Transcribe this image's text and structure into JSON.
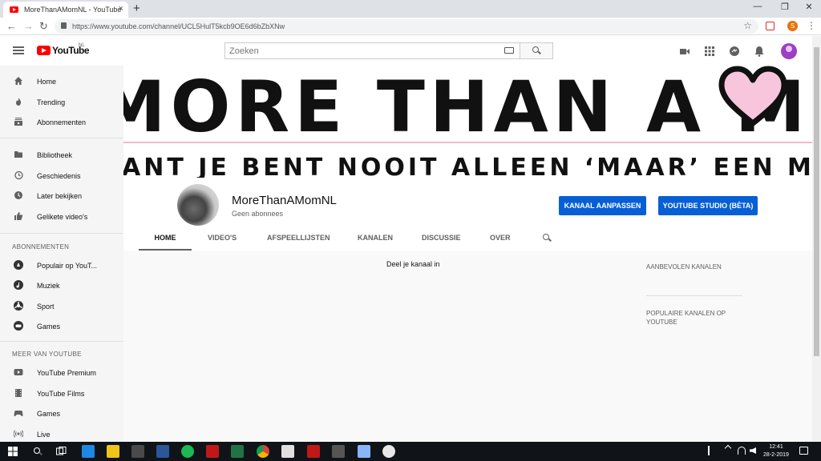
{
  "browser": {
    "tab_title": "MoreThanAMomNL - YouTube",
    "tab_close": "×",
    "new_tab": "+",
    "url": "https://www.youtube.com/channel/UCL5HulT5kcb9OE6d6bZbXNw",
    "back": "←",
    "forward": "→",
    "reload": "↻",
    "bookmark": "☆",
    "profile_initial": "S",
    "menu": "⋮",
    "win_minimize": "—",
    "win_restore": "❐",
    "win_close": "✕"
  },
  "masthead": {
    "logo_text": "YouTube",
    "country_code": "NL",
    "search_placeholder": "Zoeken"
  },
  "sidebar": {
    "primary": [
      {
        "label": "Home",
        "icon": "home-icon"
      },
      {
        "label": "Trending",
        "icon": "flame-icon"
      },
      {
        "label": "Abonnementen",
        "icon": "subscriptions-icon"
      }
    ],
    "library": [
      {
        "label": "Bibliotheek",
        "icon": "folder-icon"
      },
      {
        "label": "Geschiedenis",
        "icon": "history-icon"
      },
      {
        "label": "Later bekijken",
        "icon": "clock-icon"
      },
      {
        "label": "Gelikete video's",
        "icon": "thumbs-up-icon"
      }
    ],
    "subscriptions_heading": "ABONNEMENTEN",
    "subscriptions": [
      {
        "label": "Populair op YouT...",
        "icon": "popular-icon"
      },
      {
        "label": "Muziek",
        "icon": "music-icon"
      },
      {
        "label": "Sport",
        "icon": "sport-icon"
      },
      {
        "label": "Games",
        "icon": "games-icon"
      }
    ],
    "more_heading": "MEER VAN YOUTUBE",
    "more": [
      {
        "label": "YouTube Premium",
        "icon": "youtube-premium-icon"
      },
      {
        "label": "YouTube Films",
        "icon": "film-icon"
      },
      {
        "label": "Games",
        "icon": "gamepad-icon"
      },
      {
        "label": "Live",
        "icon": "live-icon"
      }
    ]
  },
  "banner": {
    "line1_prefix": "MORE THAN A ",
    "line1_suffix": "M",
    "line1_tail": "M",
    "line2": "ANT JE BENT NOOIT ALLEEN ‘MAAR’ EEN MOED",
    "accent_color": "#f7c6dc"
  },
  "channel": {
    "name": "MoreThanAMomNL",
    "subscribers": "Geen abonnees",
    "customize_button": "KANAAL AANPASSEN",
    "studio_button": "YOUTUBE STUDIO (BÈTA)",
    "tabs": [
      "HOME",
      "VIDEO'S",
      "AFSPEELLIJSTEN",
      "KANALEN",
      "DISCUSSIE",
      "OVER"
    ],
    "active_tab": "HOME"
  },
  "content": {
    "share_text": "Deel je kanaal in",
    "recommended_heading": "AANBEVOLEN KANALEN",
    "popular_heading": "POPULAIRE KANALEN OP YOUTUBE"
  },
  "taskbar": {
    "time": "12:41",
    "date": "28-2-2019"
  },
  "colors": {
    "youtube_red": "#ff0000",
    "button_blue": "#065fd4",
    "avatar_purple": "#9c3fc4"
  }
}
